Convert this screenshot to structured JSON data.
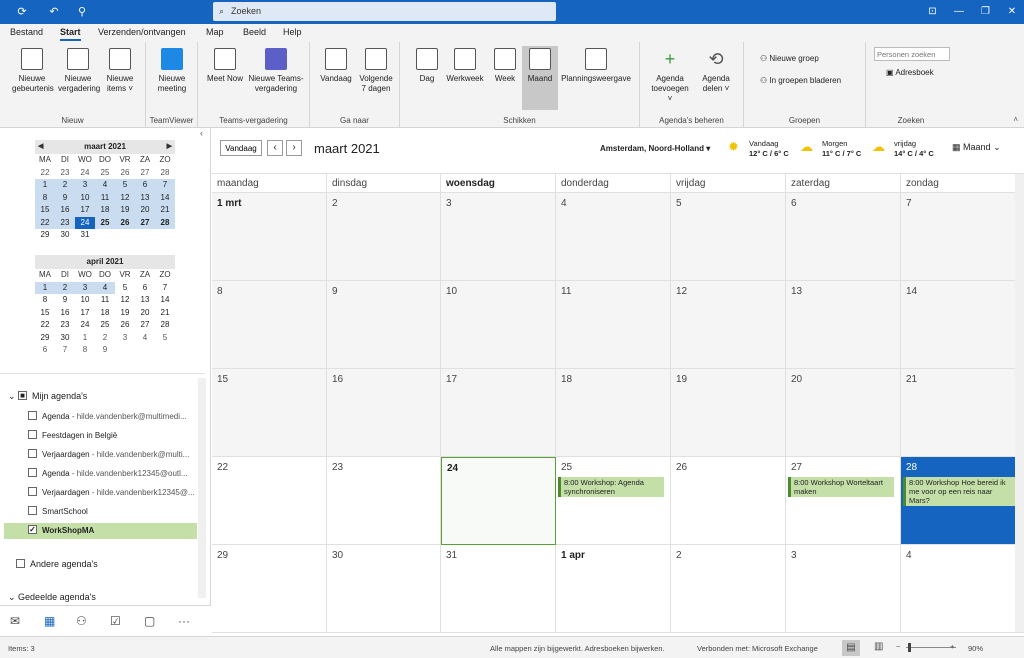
{
  "titlebar": {
    "search_label": "Zoeken"
  },
  "tabs": [
    {
      "label": "Bestand"
    },
    {
      "label": "Start"
    },
    {
      "label": "Verzenden/ontvangen"
    },
    {
      "label": "Map"
    },
    {
      "label": "Beeld"
    },
    {
      "label": "Help"
    }
  ],
  "ribbon": {
    "groups": {
      "nieuw": "Nieuw",
      "teamviewer": "TeamViewer",
      "teams": "Teams-vergadering",
      "ganaar": "Ga naar",
      "schikken": "Schikken",
      "beheren": "Agenda's beheren",
      "groepen": "Groepen",
      "zoeken": "Zoeken"
    },
    "buttons": {
      "nieuwe_gebeurtenis": "Nieuwe gebeurtenis",
      "nieuwe_vergadering": "Nieuwe vergadering",
      "nieuwe_items": "Nieuwe items ˅",
      "nieuwe_meeting": "Nieuwe meeting",
      "meet_now": "Meet Now",
      "nieuwe_teams": "Nieuwe Teams-vergadering",
      "vandaag": "Vandaag",
      "volgende7": "Volgende 7 dagen",
      "dag": "Dag",
      "werkweek": "Werkweek",
      "week": "Week",
      "maand": "Maand",
      "planning": "Planningsweergave",
      "agenda_toevoegen": "Agenda toevoegen ˅",
      "agenda_delen": "Agenda delen ˅",
      "nieuwe_groep": "Nieuwe groep",
      "in_groepen": "In groepen bladeren",
      "personen_zoeken": "Personen zoeken",
      "adresboek": "Adresboek"
    }
  },
  "minical_march": {
    "title": "maart 2021",
    "daynames": [
      "MA",
      "DI",
      "WO",
      "DO",
      "VR",
      "ZA",
      "ZO"
    ],
    "days": [
      "22",
      "23",
      "24",
      "25",
      "26",
      "27",
      "28",
      "1",
      "2",
      "3",
      "4",
      "5",
      "6",
      "7",
      "8",
      "9",
      "10",
      "11",
      "12",
      "13",
      "14",
      "15",
      "16",
      "17",
      "18",
      "19",
      "20",
      "21",
      "22",
      "23",
      "24",
      "25",
      "26",
      "27",
      "28",
      "29",
      "30",
      "31"
    ]
  },
  "minical_april": {
    "title": "april 2021",
    "daynames": [
      "MA",
      "DI",
      "WO",
      "DO",
      "VR",
      "ZA",
      "ZO"
    ],
    "days": [
      "1",
      "2",
      "3",
      "4",
      "5",
      "6",
      "7",
      "8",
      "9",
      "10",
      "11",
      "12",
      "13",
      "14",
      "15",
      "16",
      "17",
      "18",
      "19",
      "20",
      "21",
      "22",
      "23",
      "24",
      "25",
      "26",
      "27",
      "28",
      "29",
      "30",
      "1",
      "2",
      "3",
      "4",
      "5",
      "6",
      "7",
      "8",
      "9"
    ]
  },
  "folders": {
    "mijn": "Mijn agenda's",
    "items": [
      {
        "name": "Agenda",
        "sub": " - hilde.vandenberk@multimedi..."
      },
      {
        "name": "Feestdagen in België",
        "sub": ""
      },
      {
        "name": "Verjaardagen",
        "sub": " - hilde.vandenberk@multi..."
      },
      {
        "name": "Agenda",
        "sub": " - hilde.vandenberk12345@outl..."
      },
      {
        "name": "Verjaardagen",
        "sub": " - hilde.vandenberk12345@..."
      },
      {
        "name": "SmartSchool",
        "sub": ""
      },
      {
        "name": "WorkShopMA",
        "sub": ""
      }
    ],
    "andere": "Andere agenda's",
    "gedeelde": "Gedeelde agenda's"
  },
  "calendar": {
    "vandaag": "Vandaag",
    "title": "maart 2021",
    "location": "Amsterdam, Noord-Holland",
    "weather": [
      {
        "label": "Vandaag",
        "temp": "12° C / 6° C"
      },
      {
        "label": "Morgen",
        "temp": "11° C / 7° C"
      },
      {
        "label": "vrijdag",
        "temp": "14° C / 4° C"
      }
    ],
    "view": "Maand",
    "daynames": [
      "maandag",
      "dinsdag",
      "woensdag",
      "donderdag",
      "vrijdag",
      "zaterdag",
      "zondag"
    ],
    "weeks": [
      [
        "1 mrt",
        "2",
        "3",
        "4",
        "5",
        "6",
        "7"
      ],
      [
        "8",
        "9",
        "10",
        "11",
        "12",
        "13",
        "14"
      ],
      [
        "15",
        "16",
        "17",
        "18",
        "19",
        "20",
        "21"
      ],
      [
        "22",
        "23",
        "24",
        "25",
        "26",
        "27",
        "28"
      ],
      [
        "29",
        "30",
        "31",
        "1 apr",
        "2",
        "3",
        "4"
      ]
    ],
    "appointments": {
      "a25": "8:00 Workshop: Agenda synchroniseren",
      "a27": "8:00 Workshop Worteltaart maken",
      "a28": "8:00 Workshop Hoe bereid ik me voor op een reis naar Mars?"
    }
  },
  "status": {
    "items": "Items: 3",
    "updated": "Alle mappen zijn bijgewerkt.  Adresboeken bijwerken.",
    "connected": "Verbonden met: Microsoft Exchange",
    "zoom": "90%"
  }
}
